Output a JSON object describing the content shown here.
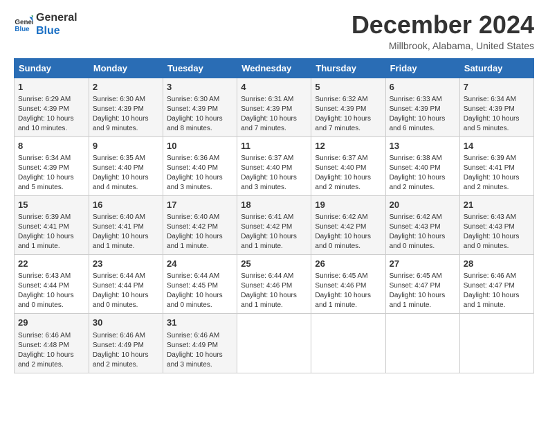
{
  "header": {
    "logo_line1": "General",
    "logo_line2": "Blue",
    "title": "December 2024",
    "subtitle": "Millbrook, Alabama, United States"
  },
  "columns": [
    "Sunday",
    "Monday",
    "Tuesday",
    "Wednesday",
    "Thursday",
    "Friday",
    "Saturday"
  ],
  "weeks": [
    [
      {
        "day": "1",
        "info": "Sunrise: 6:29 AM\nSunset: 4:39 PM\nDaylight: 10 hours and 10 minutes."
      },
      {
        "day": "2",
        "info": "Sunrise: 6:30 AM\nSunset: 4:39 PM\nDaylight: 10 hours and 9 minutes."
      },
      {
        "day": "3",
        "info": "Sunrise: 6:30 AM\nSunset: 4:39 PM\nDaylight: 10 hours and 8 minutes."
      },
      {
        "day": "4",
        "info": "Sunrise: 6:31 AM\nSunset: 4:39 PM\nDaylight: 10 hours and 7 minutes."
      },
      {
        "day": "5",
        "info": "Sunrise: 6:32 AM\nSunset: 4:39 PM\nDaylight: 10 hours and 7 minutes."
      },
      {
        "day": "6",
        "info": "Sunrise: 6:33 AM\nSunset: 4:39 PM\nDaylight: 10 hours and 6 minutes."
      },
      {
        "day": "7",
        "info": "Sunrise: 6:34 AM\nSunset: 4:39 PM\nDaylight: 10 hours and 5 minutes."
      }
    ],
    [
      {
        "day": "8",
        "info": "Sunrise: 6:34 AM\nSunset: 4:39 PM\nDaylight: 10 hours and 5 minutes."
      },
      {
        "day": "9",
        "info": "Sunrise: 6:35 AM\nSunset: 4:40 PM\nDaylight: 10 hours and 4 minutes."
      },
      {
        "day": "10",
        "info": "Sunrise: 6:36 AM\nSunset: 4:40 PM\nDaylight: 10 hours and 3 minutes."
      },
      {
        "day": "11",
        "info": "Sunrise: 6:37 AM\nSunset: 4:40 PM\nDaylight: 10 hours and 3 minutes."
      },
      {
        "day": "12",
        "info": "Sunrise: 6:37 AM\nSunset: 4:40 PM\nDaylight: 10 hours and 2 minutes."
      },
      {
        "day": "13",
        "info": "Sunrise: 6:38 AM\nSunset: 4:40 PM\nDaylight: 10 hours and 2 minutes."
      },
      {
        "day": "14",
        "info": "Sunrise: 6:39 AM\nSunset: 4:41 PM\nDaylight: 10 hours and 2 minutes."
      }
    ],
    [
      {
        "day": "15",
        "info": "Sunrise: 6:39 AM\nSunset: 4:41 PM\nDaylight: 10 hours and 1 minute."
      },
      {
        "day": "16",
        "info": "Sunrise: 6:40 AM\nSunset: 4:41 PM\nDaylight: 10 hours and 1 minute."
      },
      {
        "day": "17",
        "info": "Sunrise: 6:40 AM\nSunset: 4:42 PM\nDaylight: 10 hours and 1 minute."
      },
      {
        "day": "18",
        "info": "Sunrise: 6:41 AM\nSunset: 4:42 PM\nDaylight: 10 hours and 1 minute."
      },
      {
        "day": "19",
        "info": "Sunrise: 6:42 AM\nSunset: 4:42 PM\nDaylight: 10 hours and 0 minutes."
      },
      {
        "day": "20",
        "info": "Sunrise: 6:42 AM\nSunset: 4:43 PM\nDaylight: 10 hours and 0 minutes."
      },
      {
        "day": "21",
        "info": "Sunrise: 6:43 AM\nSunset: 4:43 PM\nDaylight: 10 hours and 0 minutes."
      }
    ],
    [
      {
        "day": "22",
        "info": "Sunrise: 6:43 AM\nSunset: 4:44 PM\nDaylight: 10 hours and 0 minutes."
      },
      {
        "day": "23",
        "info": "Sunrise: 6:44 AM\nSunset: 4:44 PM\nDaylight: 10 hours and 0 minutes."
      },
      {
        "day": "24",
        "info": "Sunrise: 6:44 AM\nSunset: 4:45 PM\nDaylight: 10 hours and 0 minutes."
      },
      {
        "day": "25",
        "info": "Sunrise: 6:44 AM\nSunset: 4:46 PM\nDaylight: 10 hours and 1 minute."
      },
      {
        "day": "26",
        "info": "Sunrise: 6:45 AM\nSunset: 4:46 PM\nDaylight: 10 hours and 1 minute."
      },
      {
        "day": "27",
        "info": "Sunrise: 6:45 AM\nSunset: 4:47 PM\nDaylight: 10 hours and 1 minute."
      },
      {
        "day": "28",
        "info": "Sunrise: 6:46 AM\nSunset: 4:47 PM\nDaylight: 10 hours and 1 minute."
      }
    ],
    [
      {
        "day": "29",
        "info": "Sunrise: 6:46 AM\nSunset: 4:48 PM\nDaylight: 10 hours and 2 minutes."
      },
      {
        "day": "30",
        "info": "Sunrise: 6:46 AM\nSunset: 4:49 PM\nDaylight: 10 hours and 2 minutes."
      },
      {
        "day": "31",
        "info": "Sunrise: 6:46 AM\nSunset: 4:49 PM\nDaylight: 10 hours and 3 minutes."
      },
      null,
      null,
      null,
      null
    ]
  ]
}
